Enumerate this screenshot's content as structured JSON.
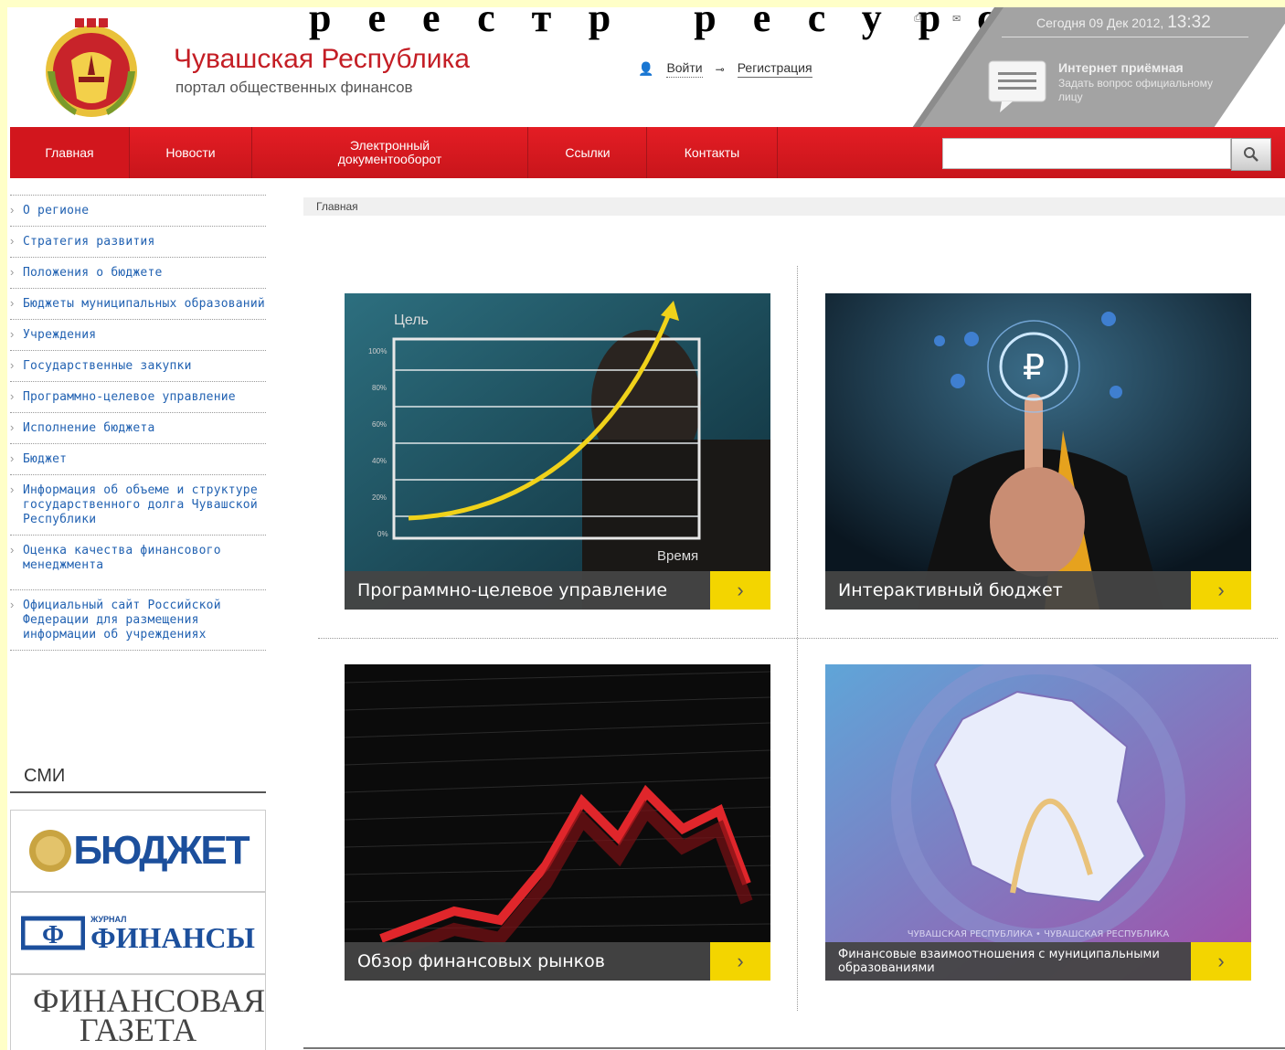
{
  "slide_heading_fragment": "реестр ресурс",
  "header": {
    "title": "Чувашская Республика",
    "subtitle": "портал общественных финансов",
    "login": "Войти",
    "register": "Регистрация",
    "date_prefix": "Сегодня 09 Дек 2012,",
    "time": "13:32",
    "reception_title": "Интернет приёмная",
    "reception_sub": "Задать вопрос официальному лицу"
  },
  "nav": {
    "items": [
      "Главная",
      "Новости",
      "Электронный документооборот",
      "Ссылки",
      "Контакты"
    ],
    "search_placeholder": ""
  },
  "sidebar": {
    "items": [
      "О регионе",
      "Стратегия развития",
      "Положения о бюджете",
      "Бюджеты муниципальных образований",
      "Учреждения",
      "Государственные закупки",
      "Программно-целевое управление",
      "Исполнение бюджета",
      "Бюджет",
      "Информация об объеме и структуре государственного долга Чувашской Республики",
      "Оценка качества финансового менеджмента",
      "Официальный сайт Российской Федерации для размещения информации об учреждениях"
    ],
    "smi_title": "СМИ",
    "media": [
      "БЮДЖЕТ",
      "ЖУРНАЛ",
      "ФИНАНСЫ",
      "ФИНАНСОВАЯ ГАЗЕТА"
    ]
  },
  "breadcrumb": "Главная",
  "tiles": [
    {
      "caption": "Программно-целевое управление",
      "chart_goal": "Цель",
      "chart_time": "Время",
      "ticks": [
        "100%",
        "80%",
        "60%",
        "40%",
        "20%",
        "0%"
      ]
    },
    {
      "caption": "Интерактивный бюджет",
      "symbol": "₽"
    },
    {
      "caption": "Обзор финансовых рынков"
    },
    {
      "caption": "Финансовые взаимоотношения с муниципальными образованиями",
      "map_label": "ЧУВАШСКАЯ РЕСПУБЛИКА • ЧУВАШСКАЯ РЕСПУБЛИКА"
    }
  ],
  "colors": {
    "brand_red": "#d2161d",
    "accent_yellow": "#f3d500",
    "link_blue": "#2262b2"
  }
}
